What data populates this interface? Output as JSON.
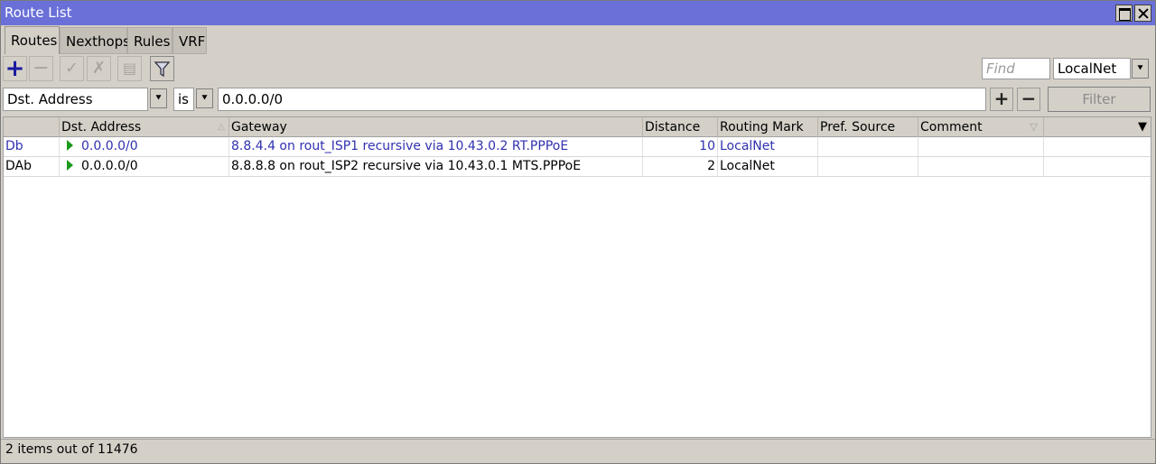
{
  "window": {
    "title": "Route List"
  },
  "tabs": [
    {
      "label": "Routes",
      "active": true
    },
    {
      "label": "Nexthops",
      "active": false
    },
    {
      "label": "Rules",
      "active": false
    },
    {
      "label": "VRF",
      "active": false
    }
  ],
  "toolbar": {
    "icons": [
      "plus-icon",
      "minus-icon",
      "check-icon",
      "cross-icon",
      "comment-icon",
      "filter-icon"
    ],
    "find_placeholder": "Find",
    "routing_mark_value": "LocalNet"
  },
  "filter": {
    "field": "Dst. Address",
    "operator": "is",
    "value": "0.0.0.0/0",
    "button_label": "Filter"
  },
  "table": {
    "columns": [
      "",
      "Dst. Address",
      "Gateway",
      "Distance",
      "Routing Mark",
      "Pref. Source",
      "Comment"
    ],
    "rows": [
      {
        "flags": "Db",
        "dst": "0.0.0.0/0",
        "gateway": "8.8.4.4 on rout_ISP1 recursive via 10.43.0.2 RT.PPPoE",
        "distance": "10",
        "mark": "LocalNet",
        "pref_source": "",
        "comment": ""
      },
      {
        "flags": "DAb",
        "dst": "0.0.0.0/0",
        "gateway": "8.8.8.8 on rout_ISP2 recursive via 10.43.0.1 MTS.PPPoE",
        "distance": "2",
        "mark": "LocalNet",
        "pref_source": "",
        "comment": ""
      }
    ]
  },
  "status": {
    "text": "2 items out of 11476"
  },
  "colors": {
    "titlebar": "#6a70d8",
    "selected_text": "#3030b0",
    "active_route_arrow": "#1a9a1a"
  }
}
